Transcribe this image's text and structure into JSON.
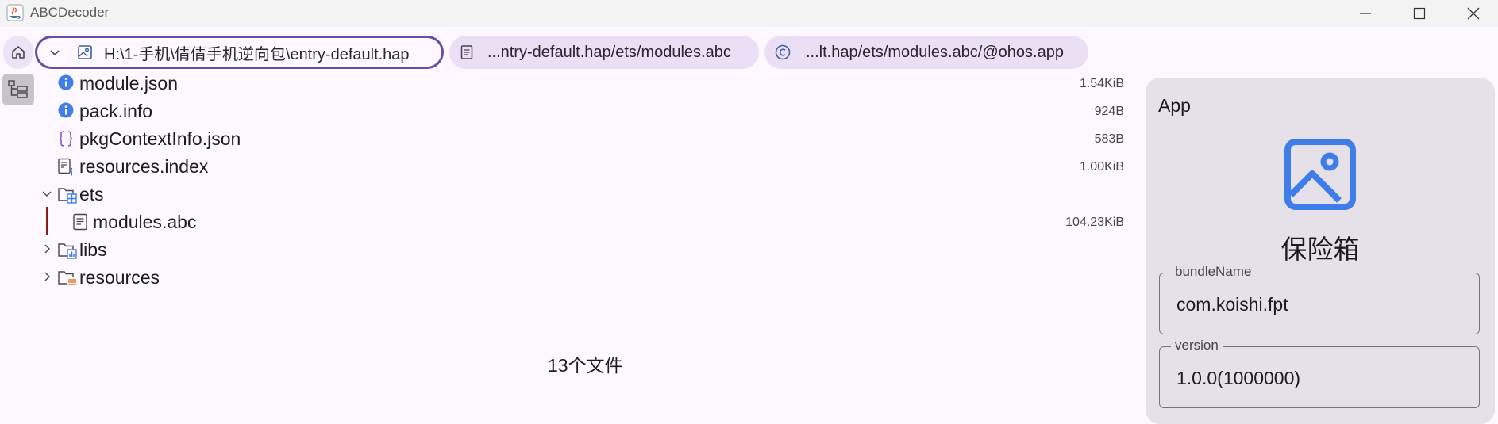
{
  "window": {
    "title": "ABCDecoder"
  },
  "breadcrumbs": [
    {
      "label": "H:\\1-手机\\倩倩手机逆向包\\entry-default.hap",
      "icon": "image-file-icon",
      "active": true
    },
    {
      "label": "...ntry-default.hap/ets/modules.abc",
      "icon": "document-icon",
      "active": false
    },
    {
      "label": "...lt.hap/ets/modules.abc/@ohos.app",
      "icon": "class-c-icon",
      "active": false
    }
  ],
  "files": [
    {
      "name": "module.json",
      "size": "1.54KiB",
      "icon": "info-icon"
    },
    {
      "name": "pack.info",
      "size": "924B",
      "icon": "info-icon"
    },
    {
      "name": "pkgContextInfo.json",
      "size": "583B",
      "icon": "json-braces-icon"
    },
    {
      "name": "resources.index",
      "size": "1.00KiB",
      "icon": "index-file-icon"
    },
    {
      "name": "ets",
      "size": "",
      "icon": "folder-icon",
      "expanded": true
    },
    {
      "name": "modules.abc",
      "size": "104.23KiB",
      "icon": "document-icon",
      "selected": true
    },
    {
      "name": "libs",
      "size": "",
      "icon": "folder-icon",
      "expanded": false
    },
    {
      "name": "resources",
      "size": "",
      "icon": "folder-icon",
      "expanded": false
    }
  ],
  "status": {
    "file_count": "13个文件"
  },
  "panel": {
    "title": "App",
    "app_name": "保险箱",
    "bundle_label": "bundleName",
    "bundle_value": "com.koishi.fpt",
    "version_label": "version",
    "version_value": "1.0.0(1000000)"
  },
  "colors": {
    "accent": "#6750a4",
    "tab_bg": "#ebdff5",
    "panel_bg": "#e6e0e9",
    "icon_blue": "#3f7ee8"
  }
}
